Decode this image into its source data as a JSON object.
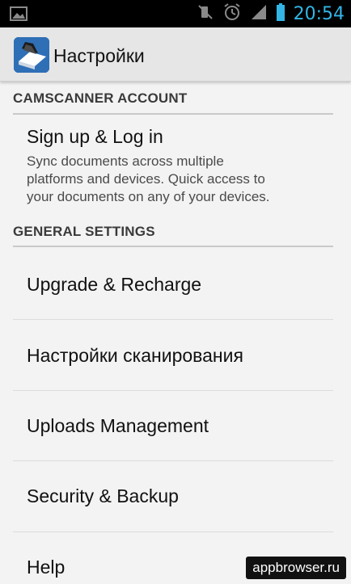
{
  "status_bar": {
    "time": "20:54",
    "icons": [
      "image-icon",
      "mute-icon",
      "alarm-icon",
      "signal-icon",
      "battery-icon"
    ]
  },
  "action_bar": {
    "title": "Настройки",
    "icon": "camscanner-logo-icon"
  },
  "sections": [
    {
      "header": "CAMSCANNER ACCOUNT",
      "items": [
        {
          "title": "Sign up & Log in",
          "summary_lines": [
            "Sync documents across multiple",
            "platforms and devices. Quick access to",
            "your documents on any of your devices."
          ]
        }
      ]
    },
    {
      "header": "GENERAL SETTINGS",
      "items": [
        {
          "title": "Upgrade & Recharge"
        },
        {
          "title": "Настройки сканирования"
        },
        {
          "title": "Uploads Management"
        },
        {
          "title": "Security & Backup"
        },
        {
          "title": "Help"
        }
      ]
    }
  ],
  "watermark": "appbrowser.ru",
  "colors": {
    "status_accent": "#33b5e5",
    "background": "#f3f3f3",
    "action_bar": "#e6e6e6",
    "app_icon": "#2f6fb6"
  }
}
